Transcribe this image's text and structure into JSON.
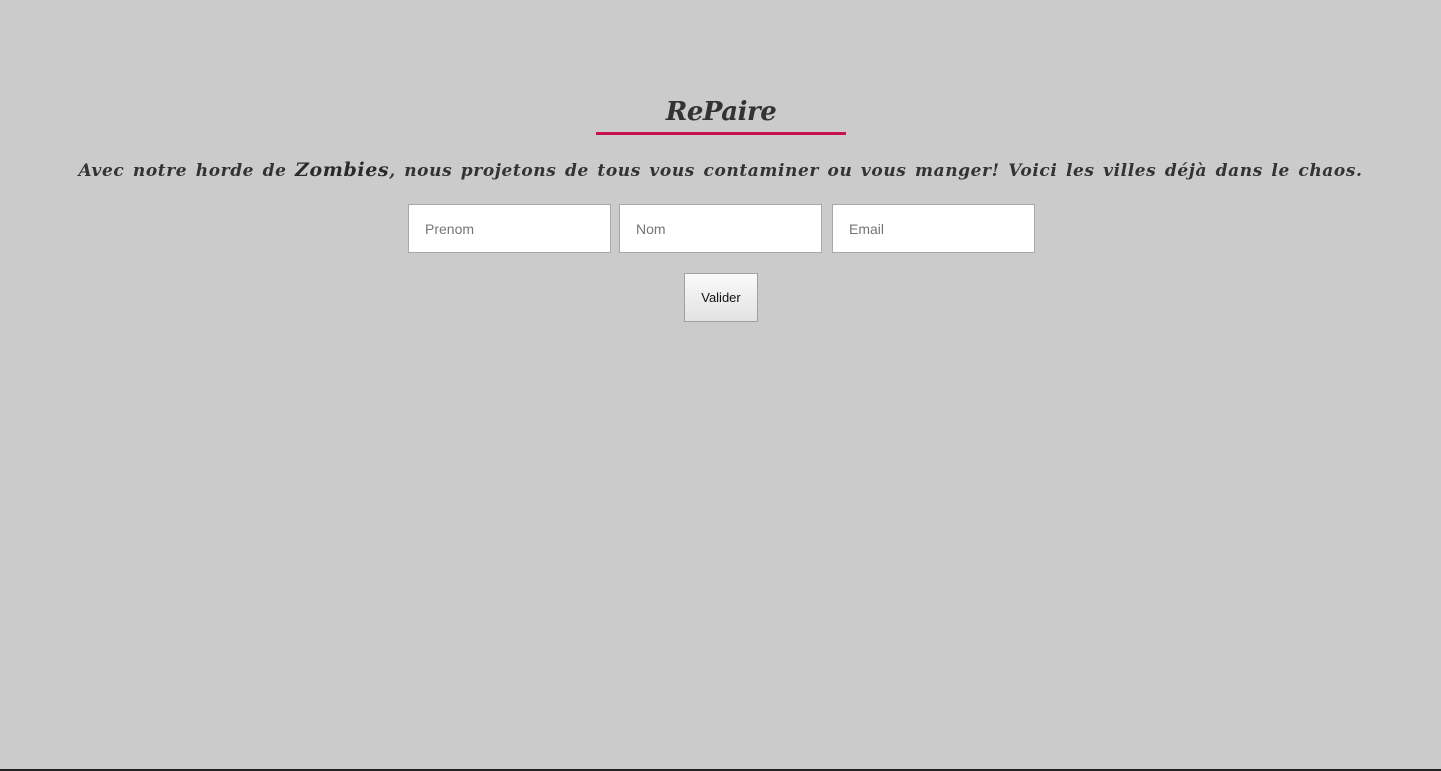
{
  "header": {
    "title": "RePaire"
  },
  "intro": {
    "part1": "Avec notre horde de ",
    "highlight": "Zombies",
    "part2": ", nous projetons de tous vous contaminer ou vous manger! Voici les villes déjà dans le chaos."
  },
  "form": {
    "firstname_placeholder": "Prenom",
    "lastname_placeholder": "Nom",
    "email_placeholder": "Email",
    "submit_label": "Valider"
  },
  "colors": {
    "background": "#cbcbcb",
    "accent": "#c8104e",
    "text": "#333333"
  }
}
